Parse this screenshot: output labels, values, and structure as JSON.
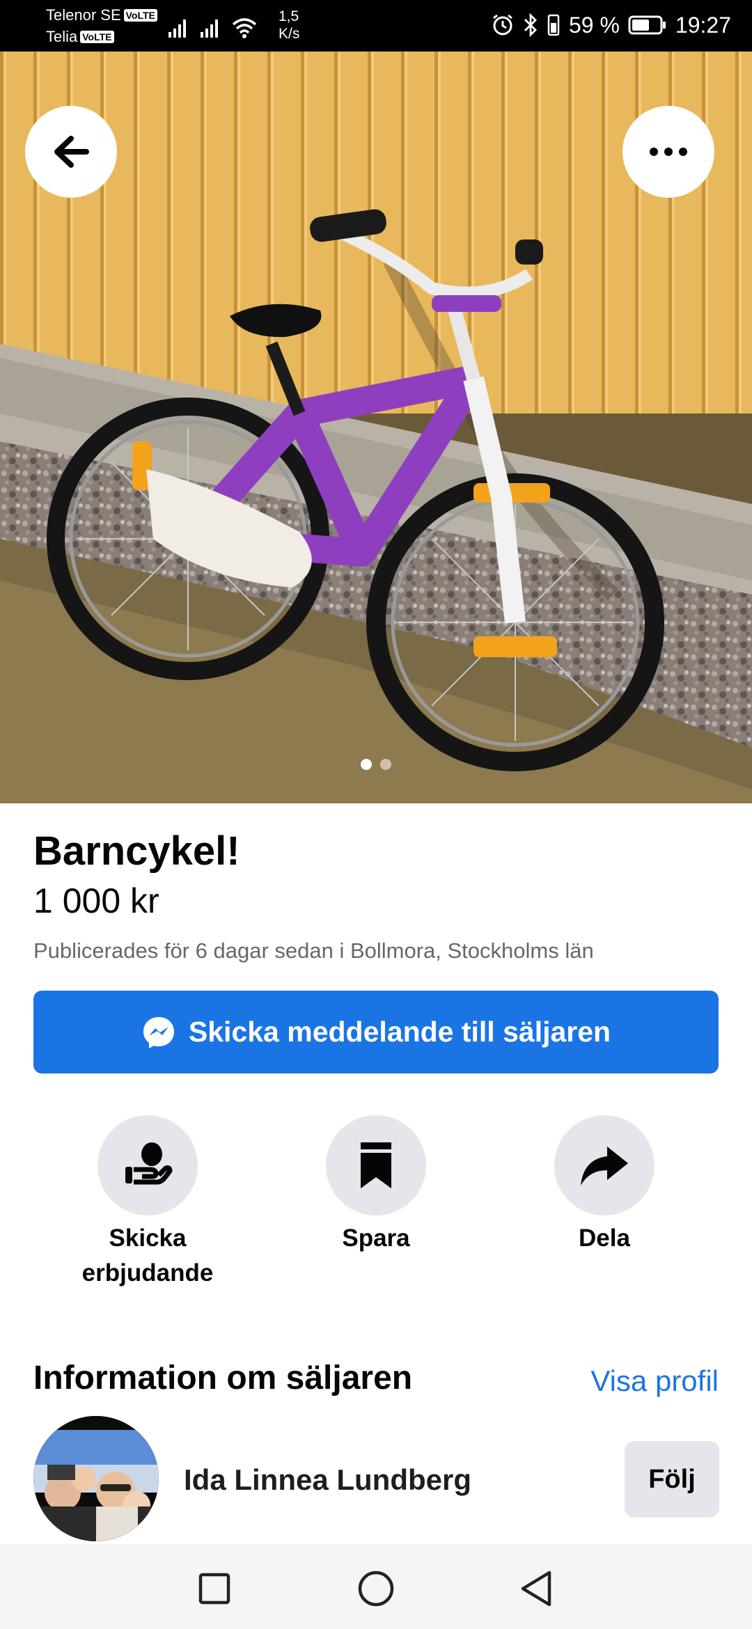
{
  "status_bar": {
    "carrier1": "Telenor SE",
    "carrier2": "Telia",
    "volte": "VoLTE",
    "speed_value": "1,5",
    "speed_unit": "K/s",
    "battery": "59 %",
    "time": "19:27"
  },
  "hero": {
    "image_count": 2,
    "active_index": 0
  },
  "listing": {
    "title": "Barncykel!",
    "price": "1 000 kr",
    "meta": "Publicerades för 6 dagar sedan i Bollmora, Stockholms län",
    "message_button": "Skicka meddelande till säljaren"
  },
  "actions": {
    "offer_line1": "Skicka",
    "offer_line2": "erbjudande",
    "save": "Spara",
    "share": "Dela"
  },
  "seller": {
    "heading": "Information om säljaren",
    "profile_link": "Visa profil",
    "name": "Ida Linnea Lundberg",
    "follow": "Följ"
  },
  "colors": {
    "accent": "#1b74e4",
    "button_bg": "#e4e6eb",
    "muted_text": "#65676b"
  },
  "icons": {
    "back": "arrow-left-icon",
    "more": "more-horizontal-icon",
    "messenger": "messenger-icon",
    "offer": "hand-coin-icon",
    "save": "bookmark-icon",
    "share": "share-arrow-icon"
  }
}
